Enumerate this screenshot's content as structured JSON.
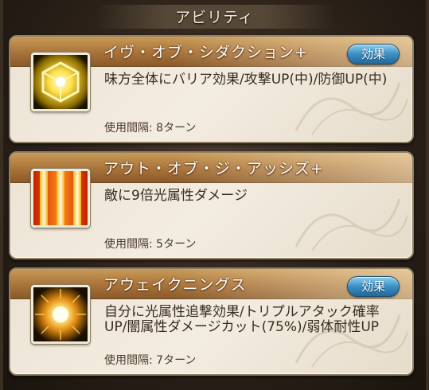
{
  "header": {
    "title": "アビリティ"
  },
  "abilities": [
    {
      "name": "イヴ・オブ・シダクション+",
      "description": "味方全体にバリア効果/攻撃UP(中)/防御UP(中)",
      "cooldown": "使用間隔: 8ターン",
      "effect_label": "効果",
      "icon": "golden-cube-icon"
    },
    {
      "name": "アウト・オブ・ジ・アッシズ+",
      "description": "敵に9倍光属性ダメージ",
      "cooldown": "使用間隔: 5ターン",
      "icon": "light-pillars-icon"
    },
    {
      "name": "アウェイクニングス",
      "description": "自分に光属性追撃効果/トリプルアタック確率UP/闇属性ダメージカット(75%)/弱体耐性UP",
      "cooldown": "使用間隔: 7ターン",
      "effect_label": "効果",
      "icon": "radiant-orb-icon"
    }
  ],
  "colors": {
    "title_bar": "#a8733a",
    "effect_button": "#3a8fc4",
    "card_bg": "#ece3d4"
  }
}
